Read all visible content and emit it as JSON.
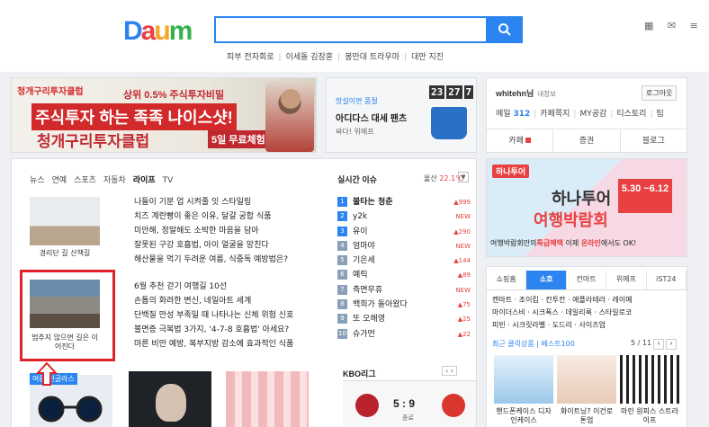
{
  "header": {
    "logo": "Daum",
    "search": {
      "value": "",
      "placeholder": ""
    },
    "trending": [
      "피부 전자회로",
      "이세돌 김장훈",
      "봉만대 트라우마",
      "대만 지진"
    ],
    "right_icons": "▦ ✉ ≡"
  },
  "ads": {
    "main": {
      "brand": "청개구리투자클럽",
      "line1": "상위 0.5% 주식투자비밀",
      "line2": "주식투자 하는 족족 나이스샷!",
      "line3": "청개구리투자클럽",
      "badge": "5일 무료체험"
    },
    "shop": {
      "tag": "망설이면 품절",
      "title": "아디다스 대세 팬츠",
      "sub": "싸다! 위메프",
      "timer": [
        "23",
        "27",
        "7"
      ]
    },
    "travel": {
      "brand": "하나투어",
      "title1": "하나투어",
      "title2": "여행박람회",
      "date": "5.30 ~6.12",
      "sub_prefix": "여행박람회만의",
      "sub_highlight": "특급혜택",
      "sub_mid": "이제",
      "sub_highlight2": "온라인",
      "sub_suffix": "에서도 OK!"
    }
  },
  "login": {
    "user": "whitehn님",
    "user_sub": "내정보",
    "logout_label": "로그아웃",
    "mail_label": "메일",
    "mail_count": "312",
    "links": [
      "카페쪽지",
      "MY공감",
      "티스토리",
      "팁"
    ],
    "tabs": [
      "카페",
      "증권",
      "블로그"
    ]
  },
  "news": {
    "tabs": [
      "뉴스",
      "연예",
      "스포츠",
      "자동차",
      "라이프",
      "TV"
    ],
    "active_tab": "라이프",
    "thumb1_caption": "경리단 길 산책길",
    "thumb2_caption": "멈추지 않으면 길은 이어진다",
    "list1": [
      "나들이 기분 업 시켜줄 잇 스타일링",
      "치즈 계란빵이 좋은 이유, 달걀 궁합 식품",
      "미안해, 정말해도 소박한 마음을 담아",
      "잘못된 구강 호흡법, 아이 얼굴을 망친다",
      "해산물을 먹기 두려운 여름, 식중독 예방법은?"
    ],
    "list2": [
      "6월 추천 걷기 여행길 10선",
      "손톱의 화려한 변신, 네일아트 세계",
      "단백질 만성 부족일 때 나타나는 신체 위험 신호",
      "불면증 극복법 3가지, '4-7-8 호흡법' 아세요?",
      "마른 비만 예방, 복부지방 감소에 효과적인 식품"
    ],
    "bottom_label": "여름 선글라스"
  },
  "realtime": {
    "title": "실시간 이슈",
    "weather_city": "울산",
    "weather_temp": "22.1℃",
    "items": [
      {
        "rank": "1",
        "keyword": "불타는 청춘",
        "delta": "▲999"
      },
      {
        "rank": "2",
        "keyword": "y2k",
        "delta": "NEW"
      },
      {
        "rank": "3",
        "keyword": "유이",
        "delta": "▲290"
      },
      {
        "rank": "4",
        "keyword": "엄마야",
        "delta": "NEW"
      },
      {
        "rank": "5",
        "keyword": "기은세",
        "delta": "▲144"
      },
      {
        "rank": "6",
        "keyword": "예릭",
        "delta": "▲89"
      },
      {
        "rank": "7",
        "keyword": "측면무휴",
        "delta": "NEW"
      },
      {
        "rank": "8",
        "keyword": "백희가 돌아왔다",
        "delta": "▲75"
      },
      {
        "rank": "9",
        "keyword": "또 오해영",
        "delta": "▲25"
      },
      {
        "rank": "10",
        "keyword": "슈가먼",
        "delta": "▲22"
      }
    ]
  },
  "kbo": {
    "title": "KBO리그",
    "nav": "‹ ›",
    "score": "5 : 9",
    "status": "종료"
  },
  "shopping": {
    "tabs": [
      "쇼핑홈",
      "소호",
      "컨마트",
      "위메프",
      "iST24"
    ],
    "active_tab": "소호",
    "links": "캔마트 · 조이킴 · 칸투칸 · 애플라테라 · 레이메\n마이더스비 · 시크폭스 · 데일리룩 · 스타일로코\n피빈 · 시크릿라벨 · 도드리 · 사이즈업",
    "recent": "최근 클릭상품 | 베스트100",
    "pager": "5 / 11",
    "products": [
      {
        "caption": "핸드폰케이스 디자인케이스"
      },
      {
        "caption": "화이트닝? 이건로 톤업"
      },
      {
        "caption": "마린 원피스 스트라이프"
      }
    ]
  }
}
